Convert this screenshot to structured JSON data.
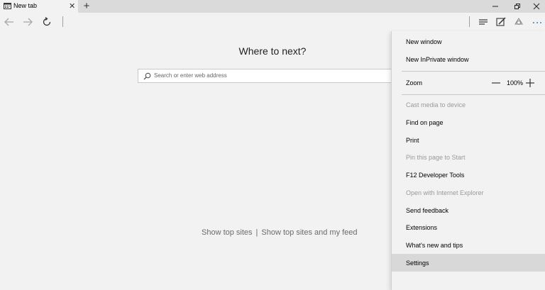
{
  "tab": {
    "title": "New tab"
  },
  "page": {
    "heading": "Where to next?",
    "search_placeholder": "Search or enter web address",
    "show_top_sites": "Show top sites",
    "separator": "|",
    "show_top_sites_feed": "Show top sites and my feed"
  },
  "menu": {
    "new_window": "New window",
    "new_inprivate": "New InPrivate window",
    "zoom_label": "Zoom",
    "zoom_value": "100%",
    "cast": "Cast media to device",
    "find": "Find on page",
    "print": "Print",
    "pin": "Pin this page to Start",
    "devtools": "F12 Developer Tools",
    "open_ie": "Open with Internet Explorer",
    "feedback": "Send feedback",
    "extensions": "Extensions",
    "whats_new": "What's new and tips",
    "settings": "Settings"
  },
  "icons": {
    "tab": "tab-icon",
    "back": "back-arrow-icon",
    "forward": "forward-arrow-icon",
    "refresh": "refresh-icon",
    "hub": "hub-icon",
    "notes": "web-note-icon",
    "share": "share-icon",
    "more": "more-icon",
    "search": "search-icon"
  },
  "colors": {
    "accent": "#2b88d8",
    "menu_bg": "#f2f2f2",
    "hover": "#d8d8d8"
  }
}
